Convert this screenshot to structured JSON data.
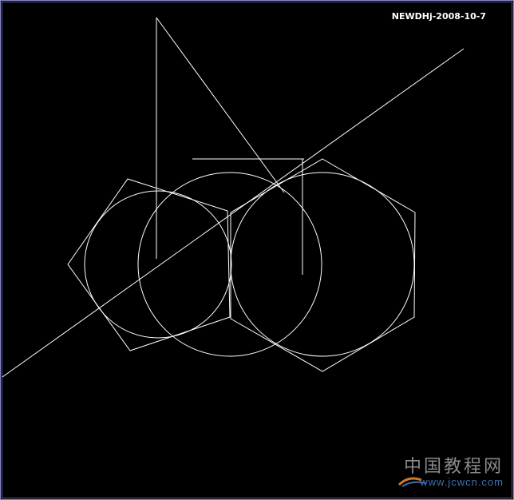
{
  "stamp": {
    "text": "NEWDHj-2008-10-7"
  },
  "watermark": {
    "chinese": "中国教程网",
    "url": "www.jcwcn.com"
  },
  "colors": {
    "background": "#000000",
    "stroke": "#ffffff",
    "frame_border": "#8a8ac8",
    "watermark_text": "#8a8a8a",
    "watermark_url": "#3f6fb0"
  }
}
